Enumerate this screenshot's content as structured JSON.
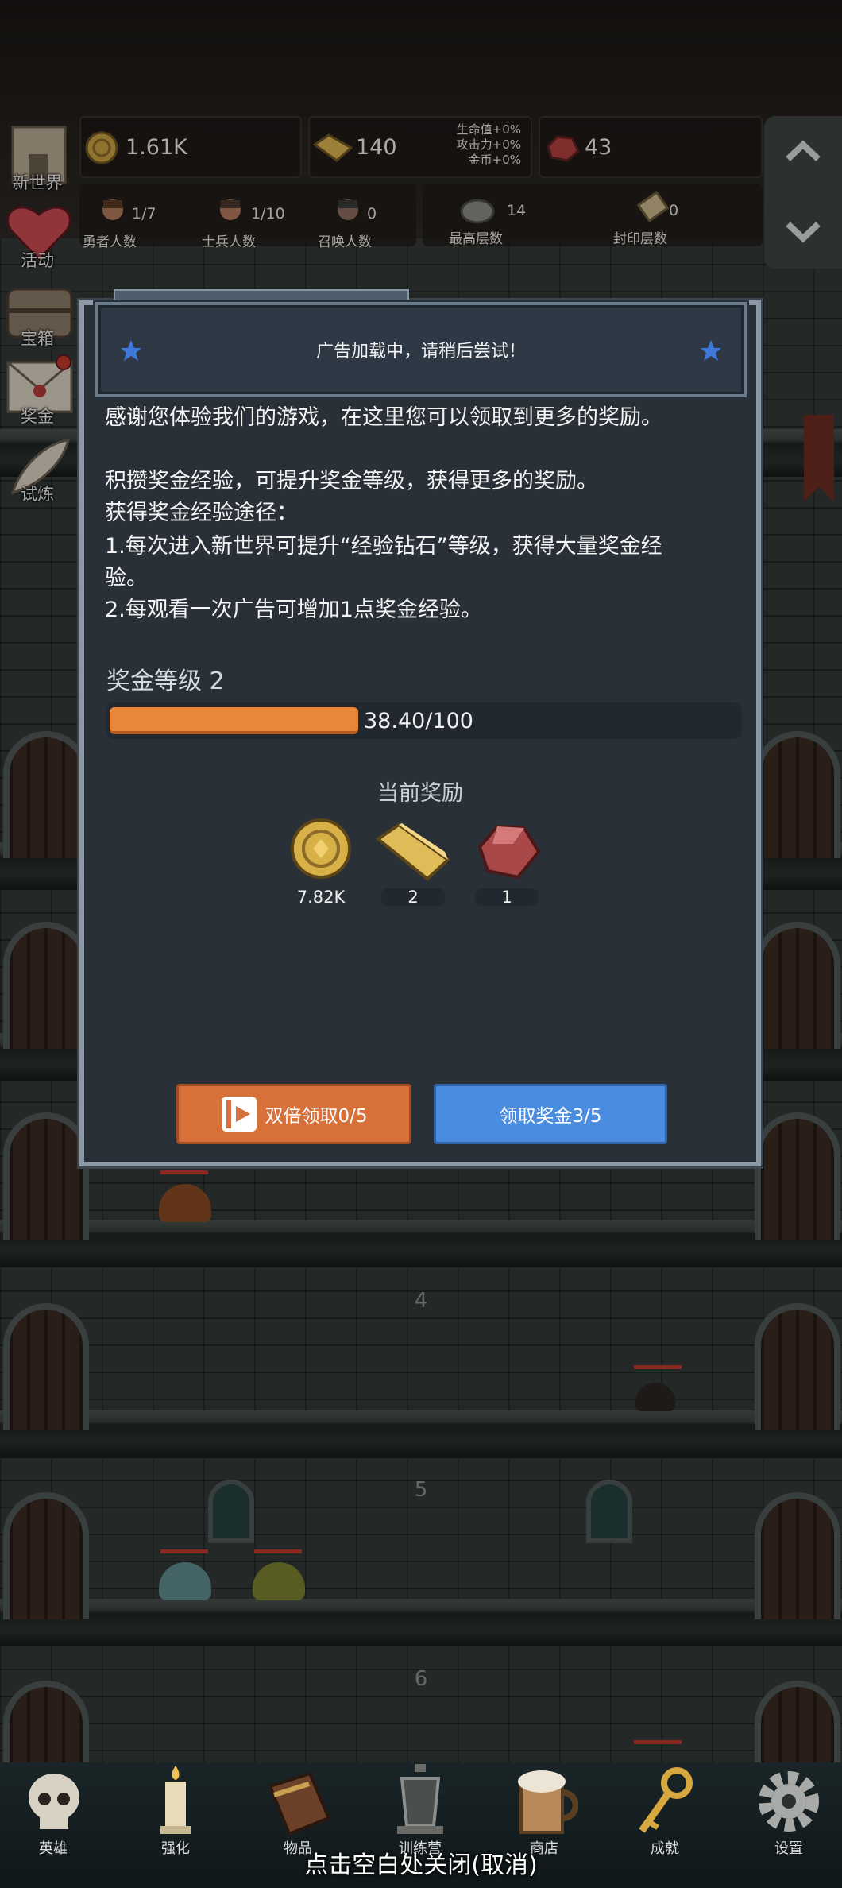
{
  "hud": {
    "gold": "1.61K",
    "gold_bars": "140",
    "buffs": [
      "生命值+0%",
      "攻击力+0%",
      "金币+0%"
    ],
    "gems": "43",
    "heroes": {
      "value": "1/7",
      "label": "勇者人数"
    },
    "soldiers": {
      "value": "1/10",
      "label": "士兵人数"
    },
    "summons": {
      "value": "0",
      "label": "召唤人数"
    },
    "top_floor": {
      "value": "14",
      "label": "最高层数"
    },
    "seal_floor": {
      "value": "0",
      "label": "封印层数"
    }
  },
  "side_menu": [
    {
      "label": "新世界",
      "icon": "castle-icon"
    },
    {
      "label": "活动",
      "icon": "heart-icon"
    },
    {
      "label": "宝箱",
      "icon": "treasure-chest-icon"
    },
    {
      "label": "奖金",
      "icon": "envelope-icon"
    },
    {
      "label": "试炼",
      "icon": "feather-icon"
    }
  ],
  "floors": [
    "4",
    "5",
    "6"
  ],
  "toast": {
    "text": "广告加载中，请稍后尝试！"
  },
  "dialog": {
    "intro": "感谢您体验我们的游戏，在这里您可以领取到更多的奖励。",
    "line2": "积攒奖金经验，可提升奖金等级，获得更多的奖励。",
    "line3": "获得奖金经验途径：",
    "line4a": "1.每次进入新世界可提升“经验钻石”等级，获得大量奖金经",
    "line4b": "验。",
    "line5": "2.每观看一次广告可增加1点奖金经验。",
    "level_label": "奖金等级 2",
    "progress_text": "38.40/100",
    "progress_fraction": 0.384,
    "rewards_title": "当前奖励",
    "rewards": [
      {
        "icon": "gold-coin-icon",
        "value": "7.82K"
      },
      {
        "icon": "gold-bar-icon",
        "value": "2"
      },
      {
        "icon": "red-gem-icon",
        "value": "1"
      }
    ],
    "double_button": "双倍领取0/5",
    "claim_button": "领取奖金3/5"
  },
  "bottom_nav": [
    {
      "label": "英雄",
      "icon": "skull-icon"
    },
    {
      "label": "强化",
      "icon": "candle-icon"
    },
    {
      "label": "物品",
      "icon": "book-icon"
    },
    {
      "label": "训练营",
      "icon": "lantern-icon"
    },
    {
      "label": "商店",
      "icon": "mug-icon"
    },
    {
      "label": "成就",
      "icon": "key-icon"
    },
    {
      "label": "设置",
      "icon": "gear-icon"
    }
  ],
  "close_hint": "点击空白处关闭(取消)",
  "colors": {
    "accent_orange": "#e07a3a",
    "accent_blue": "#4a8ce0",
    "progress_fill": "#e8873a",
    "dialog_bg": "#2a3038"
  }
}
